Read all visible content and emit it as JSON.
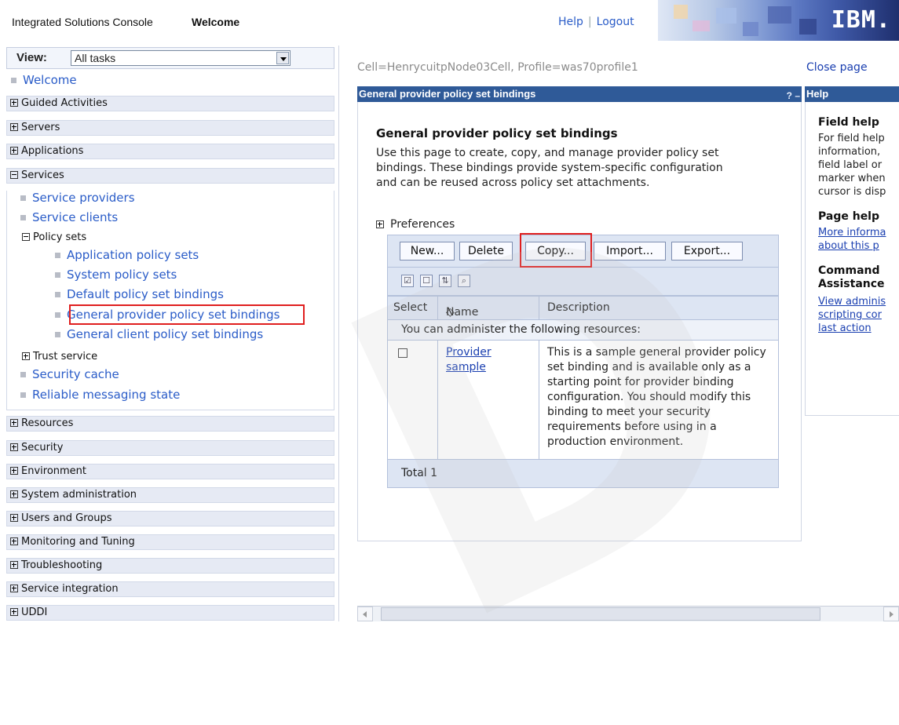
{
  "banner": {
    "title": "Integrated Solutions Console",
    "welcome": "Welcome",
    "help_link": "Help",
    "separator": "|",
    "logout_link": "Logout",
    "logo": "IBM."
  },
  "nav": {
    "view_label": "View:",
    "view_value": "All tasks",
    "welcome": "Welcome",
    "categories": [
      {
        "label": "Guided Activities",
        "expanded": false
      },
      {
        "label": "Servers",
        "expanded": false
      },
      {
        "label": "Applications",
        "expanded": false
      },
      {
        "label": "Services",
        "expanded": true
      },
      {
        "label": "Resources",
        "expanded": false
      },
      {
        "label": "Security",
        "expanded": false
      },
      {
        "label": "Environment",
        "expanded": false
      },
      {
        "label": "System administration",
        "expanded": false
      },
      {
        "label": "Users and Groups",
        "expanded": false
      },
      {
        "label": "Monitoring and Tuning",
        "expanded": false
      },
      {
        "label": "Troubleshooting",
        "expanded": false
      },
      {
        "label": "Service integration",
        "expanded": false
      },
      {
        "label": "UDDI",
        "expanded": false
      }
    ],
    "services_items": {
      "service_providers": "Service providers",
      "service_clients": "Service clients",
      "policy_sets": "Policy sets",
      "application_policy_sets": "Application policy sets",
      "system_policy_sets": "System policy sets",
      "default_policy_set_bindings": "Default policy set bindings",
      "general_provider_policy_set_bindings": "General provider policy set bindings",
      "general_client_policy_set_bindings": "General client policy set bindings",
      "trust_service": "Trust service",
      "security_cache": "Security cache",
      "reliable_messaging_state": "Reliable messaging state"
    }
  },
  "main": {
    "cell_line": "Cell=HenrycuitpNode03Cell, Profile=was70profile1",
    "close_page": "Close page",
    "portlet_title": "General provider policy set bindings",
    "portlet_controls": "? –",
    "heading": "General provider policy set bindings",
    "description": "Use this page to create, copy, and manage provider policy set bindings. These bindings provide system-specific configuration and can be reused across policy set attachments.",
    "preferences": "Preferences",
    "buttons": {
      "new": "New...",
      "delete": "Delete",
      "copy": "Copy...",
      "import": "Import...",
      "export": "Export..."
    },
    "table": {
      "headers": {
        "select": "Select",
        "name": "Name",
        "sort_glyph": "◇",
        "description": "Description"
      },
      "resources_message": "You can administer the following resources:",
      "rows": [
        {
          "name": "Provider sample",
          "description": "This is a sample general provider policy set binding and is available only as a starting point for provider binding configuration. You should modify this binding to meet your security requirements before using in a production environment."
        }
      ],
      "total_label": "Total",
      "total_value": "1"
    }
  },
  "help": {
    "title": "Help",
    "field_help_heading": "Field help",
    "field_help_lines": [
      "For field help",
      "information,",
      "field label or",
      "marker when",
      "cursor is disp"
    ],
    "page_help_heading": "Page help",
    "page_help_links": [
      "More informa",
      "about this p"
    ],
    "command_heading_1": "Command",
    "command_heading_2": "Assistance",
    "command_links": [
      "View adminis",
      "scripting cor",
      "last action"
    ]
  },
  "colors": {
    "portlet_title_bg": "#2f5a98",
    "link": "#1a3fb0",
    "highlight": "#e01e1e",
    "table_header_bg": "#dde5f3"
  }
}
